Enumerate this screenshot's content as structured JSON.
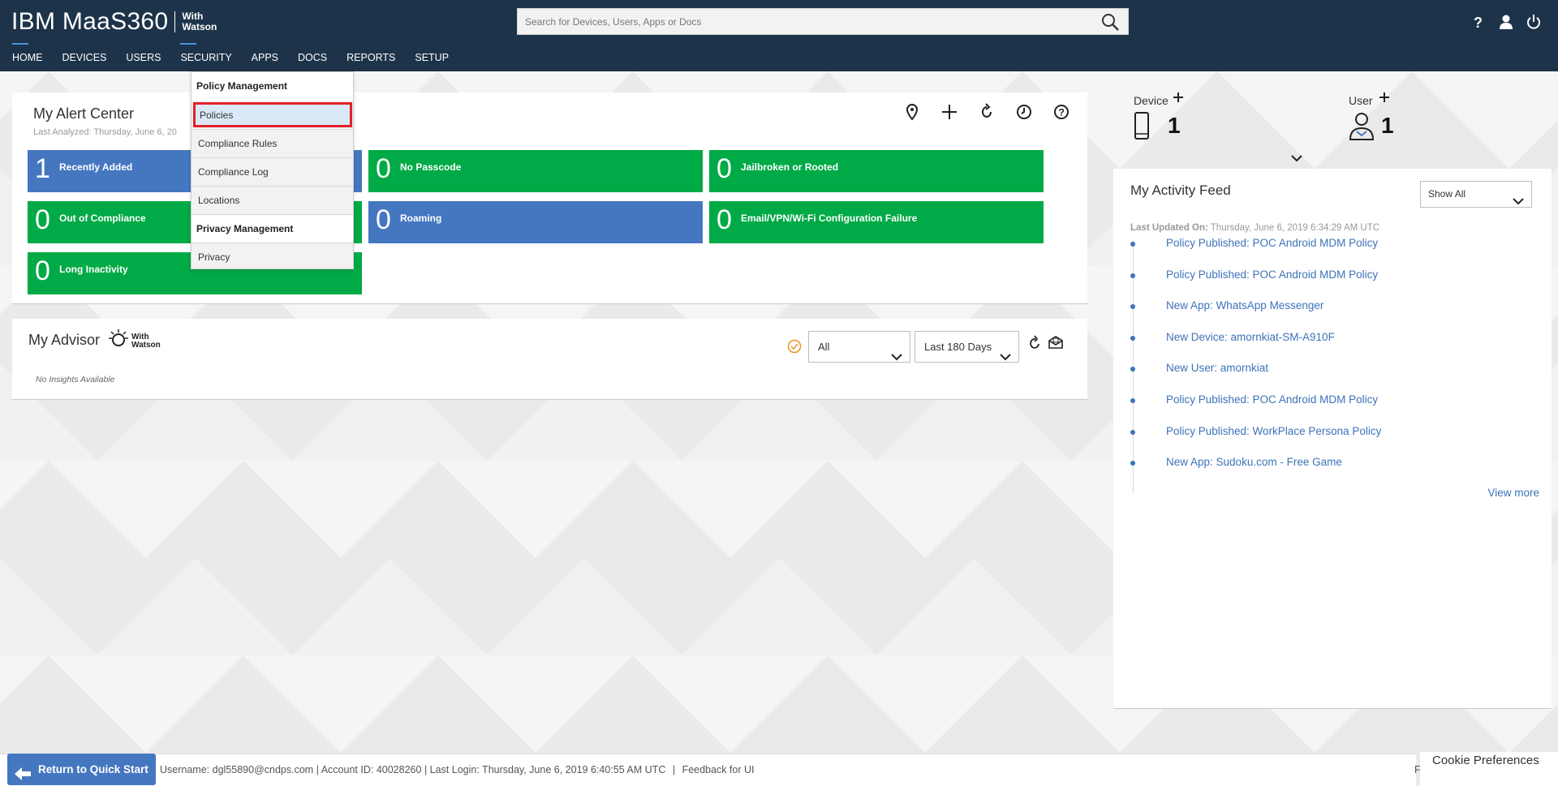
{
  "header": {
    "logo_main": "IBM MaaS360",
    "logo_sub_line1": "With",
    "logo_sub_line2": "Watson",
    "search_placeholder": "Search for Devices, Users, Apps or Docs"
  },
  "nav": {
    "items": [
      "HOME",
      "DEVICES",
      "USERS",
      "SECURITY",
      "APPS",
      "DOCS",
      "REPORTS",
      "SETUP"
    ]
  },
  "security_menu": {
    "policy_heading": "Policy Management",
    "policy_items": [
      "Policies",
      "Compliance Rules",
      "Compliance Log",
      "Locations"
    ],
    "privacy_heading": "Privacy Management",
    "privacy_items": [
      "Privacy"
    ]
  },
  "alert_center": {
    "title": "My Alert Center",
    "last_analyzed": "Last Analyzed: Thursday, June 6, 20",
    "tiles": [
      {
        "count": "1",
        "label": "Recently Added",
        "color": "#4577c1"
      },
      {
        "count": "0",
        "label": "No Passcode",
        "color": "#00aa46"
      },
      {
        "count": "0",
        "label": "Jailbroken or Rooted",
        "color": "#00aa46"
      },
      {
        "count": "0",
        "label": "Out of Compliance",
        "color": "#00aa46"
      },
      {
        "count": "0",
        "label": "Roaming",
        "color": "#4577c1"
      },
      {
        "count": "0",
        "label": "Email/VPN/Wi-Fi Configuration Failure",
        "color": "#00aa46"
      },
      {
        "count": "0",
        "label": "Long Inactivity",
        "color": "#00aa46"
      }
    ]
  },
  "advisor": {
    "title": "My Advisor",
    "badge_line1": "With",
    "badge_line2": "Watson",
    "empty_text": "No Insights Available",
    "filter_selected": "All",
    "range_selected": "Last 180 Days"
  },
  "stats": {
    "device_label": "Device",
    "device_count": "1",
    "user_label": "User",
    "user_count": "1"
  },
  "activity_feed": {
    "title": "My Activity Feed",
    "filter_selected": "Show All",
    "updated_label": "Last Updated On:",
    "updated_value": "Thursday, June 6, 2019 6:34:29 AM UTC",
    "items": [
      "Policy Published: POC Android MDM Policy",
      "Policy Published: POC Android MDM Policy",
      "New App: WhatsApp Messenger",
      "New Device: amornkiat-SM-A910F",
      "New User: amornkiat",
      "Policy Published: POC Android MDM Policy",
      "Policy Published: WorkPlace Persona Policy",
      "New App: Sudoku.com - Free Game"
    ],
    "view_more": "View more"
  },
  "footer": {
    "quick_start": "Return to Quick Start",
    "username_label": "Username:",
    "username": "dgl55890@cndps.com",
    "account_label": "| Account ID:",
    "account_id": "40028260",
    "last_login": "| Last Login: Thursday, June 6, 2019 6:40:55 AM UTC",
    "feedback": "Feedback for UI",
    "cookie": "Cookie Preferences",
    "trailing": "F"
  }
}
